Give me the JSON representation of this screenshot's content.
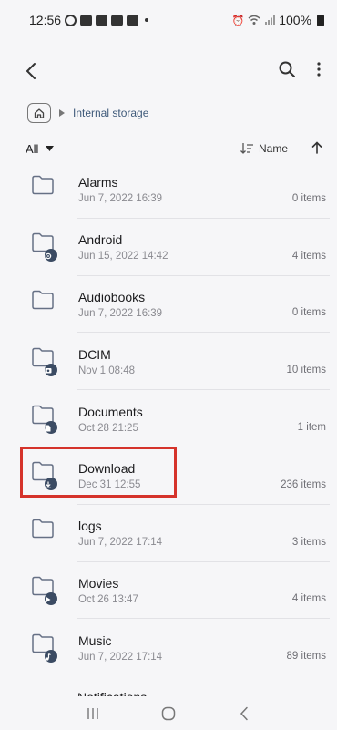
{
  "status_bar": {
    "time": "12:56",
    "battery": "100%"
  },
  "breadcrumb": {
    "label": "Internal storage"
  },
  "filter": {
    "label": "All",
    "sort_label": "Name"
  },
  "folders": [
    {
      "name": "Alarms",
      "date": "Jun 7, 2022 16:39",
      "count": "0 items",
      "badge": "none"
    },
    {
      "name": "Android",
      "date": "Jun 15, 2022 14:42",
      "count": "4 items",
      "badge": "gear-icon"
    },
    {
      "name": "Audiobooks",
      "date": "Jun 7, 2022 16:39",
      "count": "0 items",
      "badge": "none"
    },
    {
      "name": "DCIM",
      "date": "Nov 1 08:48",
      "count": "10 items",
      "badge": "camera-icon"
    },
    {
      "name": "Documents",
      "date": "Oct 28 21:25",
      "count": "1 item",
      "badge": "document-icon"
    },
    {
      "name": "Download",
      "date": "Dec 31 12:55",
      "count": "236 items",
      "badge": "download-icon"
    },
    {
      "name": "logs",
      "date": "Jun 7, 2022 17:14",
      "count": "3 items",
      "badge": "none"
    },
    {
      "name": "Movies",
      "date": "Oct 26 13:47",
      "count": "4 items",
      "badge": "play-icon"
    },
    {
      "name": "Music",
      "date": "Jun 7, 2022 17:14",
      "count": "89 items",
      "badge": "music-note-icon"
    }
  ],
  "partial_row": {
    "name": "Notifications"
  },
  "colors": {
    "highlight": "#d5332b",
    "breadcrumb": "#3f5a7a"
  }
}
